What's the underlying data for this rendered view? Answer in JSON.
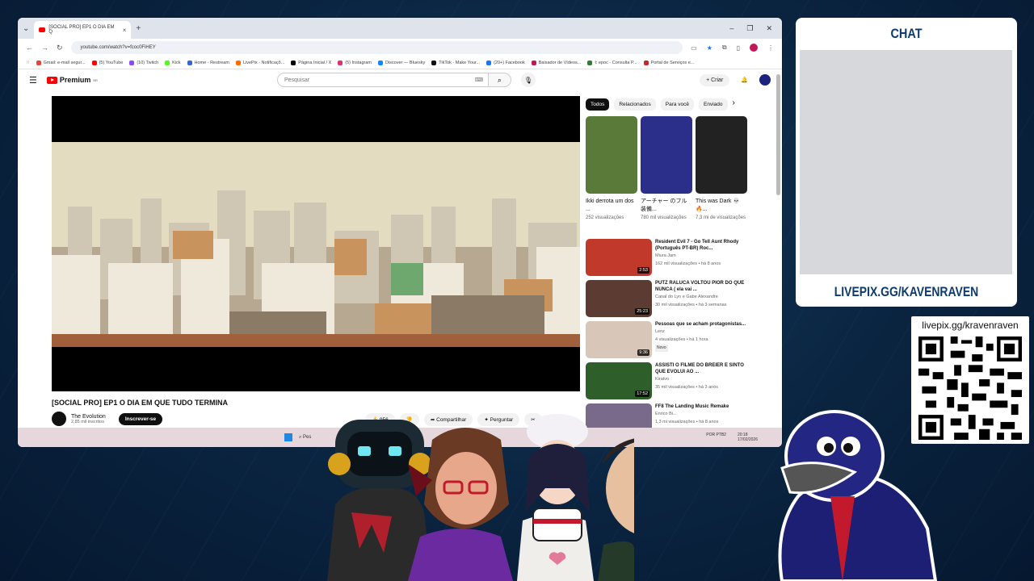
{
  "browser": {
    "tab_title": "[SOCIAL PRO] EP1 O DIA EM Q",
    "url": "youtube.com/watch?v=fcoc0FiHEY",
    "bookmarks": [
      "Gmail: e-mail segur...",
      "(5) YouTube",
      "(10) Twitch",
      "Kick",
      "Home - Restream",
      "LivePix - Notificaçõ...",
      "Página Inicial / X",
      "(5) Instagram",
      "Discover — Bluesky",
      "TikTok - Make Your...",
      "(20+) Facebook",
      "Baixador de Vídeos...",
      "I: epoc - Consulta P...",
      "Portal de Serviços e..."
    ]
  },
  "youtube": {
    "logo_text": "Premium",
    "logo_region": "BR",
    "search_placeholder": "Pesquisar",
    "create_label": "Criar",
    "video_title": "[SOCIAL PRO] EP1 O DIA EM QUE TUDO TERMINA",
    "channel_name": "The Evolution",
    "channel_subs": "2,85 mil inscritos",
    "subscribe_label": "Inscrever-se",
    "likes": "956",
    "share_label": "Compartilhar",
    "ask_label": "Perguntar",
    "chips": [
      "Todos",
      "Relacionados",
      "Para você",
      "Enviado"
    ],
    "shorts": [
      {
        "title": "Ikki derrota um dos ...",
        "views": "252 visualizações",
        "color": "#5a7a3a"
      },
      {
        "title": "アーチャー のフル装備...",
        "views": "780 mil visualizações",
        "color": "#2b2f8a"
      },
      {
        "title": "This was Dark 💀 🔥...",
        "views": "7,3 mi de visualizações",
        "color": "#222222"
      }
    ],
    "recommended": [
      {
        "title": "Resident Evil 7 - Go Tell Aunt Rhody (Português PT-BR) Roc...",
        "channel": "Miura Jam",
        "stats": "162 mil visualizações • há 8 anos",
        "duration": "2:53",
        "color": "#c0392b",
        "badge": ""
      },
      {
        "title": "PUTZ RALUCA VOLTOU PIOR DO QUE NUNCA ( ela vai ...",
        "channel": "Canal do Lyn e Gabe Alexandre",
        "stats": "30 mil visualizações • há 3 semanas",
        "duration": "25:23",
        "color": "#5b3b32",
        "badge": ""
      },
      {
        "title": "Pessoas que se acham protagonistas...",
        "channel": "Lenz",
        "stats": "4 visualizações • há 1 hora",
        "duration": "9:36",
        "color": "#d8c7b8",
        "badge": "Novo"
      },
      {
        "title": "ASSISTI O FILME DO BREIER E SINTO QUE EVOLUI AO ...",
        "channel": "Kiratvo",
        "stats": "35 mil visualizações • há 3 anos",
        "duration": "17:52",
        "color": "#2e5e2a",
        "badge": ""
      },
      {
        "title": "FF8 The Landing Music Remake",
        "channel": "Enrico Bi...",
        "stats": "1,3 mi visualizações • há 8 anos",
        "duration": "",
        "color": "#7a6a8a",
        "badge": ""
      }
    ],
    "activate_windows": "Ativar o Windows"
  },
  "taskbar": {
    "search": "Pes",
    "lang": "POR PTB2",
    "time": "20:18",
    "date": "17/02/2026"
  },
  "overlay": {
    "chat_title": "CHAT",
    "chat_link": "LIVEPIX.GG/KAVENRAVEN",
    "qr_text": "livepix.gg/kravenraven"
  }
}
